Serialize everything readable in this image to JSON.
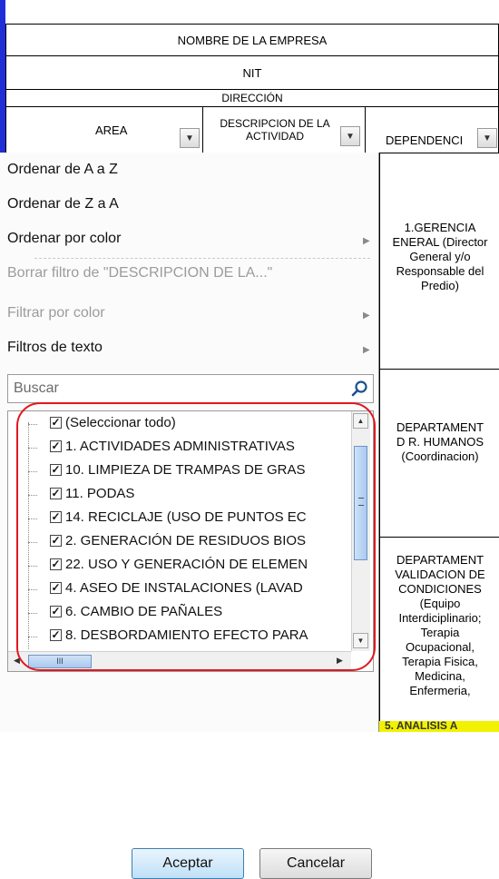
{
  "sheet": {
    "company_name": "NOMBRE DE LA EMPRESA",
    "nit": "NIT",
    "address": "DIRECCIÓN",
    "headers": {
      "area": "AREA",
      "activity_line1": "DESCRIPCION DE LA",
      "activity_line2": "ACTIVIDAD",
      "dependency": "DEPENDENCI"
    },
    "dependency_cells": [
      [
        "1.GERENCIA",
        "ENERAL (Director",
        "General y/o",
        "Responsable del",
        "Predio)"
      ],
      [
        "DEPARTAMENT",
        "D R. HUMANOS",
        "(Coordinacion)"
      ],
      [
        "DEPARTAMENT",
        "VALIDACION DE",
        "CONDICIONES",
        "(Equipo",
        "Interdiciplinario;",
        "Terapia",
        "Ocupacional,",
        "Terapia Fisica,",
        "Medicina,",
        "Enfermeria,"
      ]
    ],
    "bottom_highlight_text": "5. ANALISIS A",
    "highlight_color": "#f2f200",
    "frame_color": "#1f2ed6"
  },
  "menu": {
    "sort_az": "Ordenar de A a Z",
    "sort_za": "Ordenar de Z a A",
    "sort_by_color": "Ordenar por color",
    "clear_filter": "Borrar filtro de \"DESCRIPCION DE LA...\"",
    "filter_by_color": "Filtrar por color",
    "text_filters": "Filtros de texto",
    "search_placeholder": "Buscar",
    "items": [
      {
        "label": "(Seleccionar todo)",
        "checked": true
      },
      {
        "label": "1. ACTIVIDADES ADMINISTRATIVAS",
        "checked": true
      },
      {
        "label": "10. LIMPIEZA DE TRAMPAS DE GRAS",
        "checked": true
      },
      {
        "label": "11. PODAS",
        "checked": true
      },
      {
        "label": "14. RECICLAJE (USO DE PUNTOS EC",
        "checked": true
      },
      {
        "label": "2. GENERACIÓN DE RESIDUOS BIOS",
        "checked": true
      },
      {
        "label": "22. USO Y GENERACIÓN DE ELEMEN",
        "checked": true
      },
      {
        "label": "4. ASEO DE INSTALACIONES (LAVAD",
        "checked": true
      },
      {
        "label": "6. CAMBIO DE PAÑALES",
        "checked": true
      },
      {
        "label": "8. DESBORDAMIENTO EFECTO PARA",
        "checked": true
      }
    ],
    "ok_button": "Aceptar",
    "cancel_button": "Cancelar",
    "hscroll_grip": "III",
    "highlight_color": "#e0191f"
  }
}
